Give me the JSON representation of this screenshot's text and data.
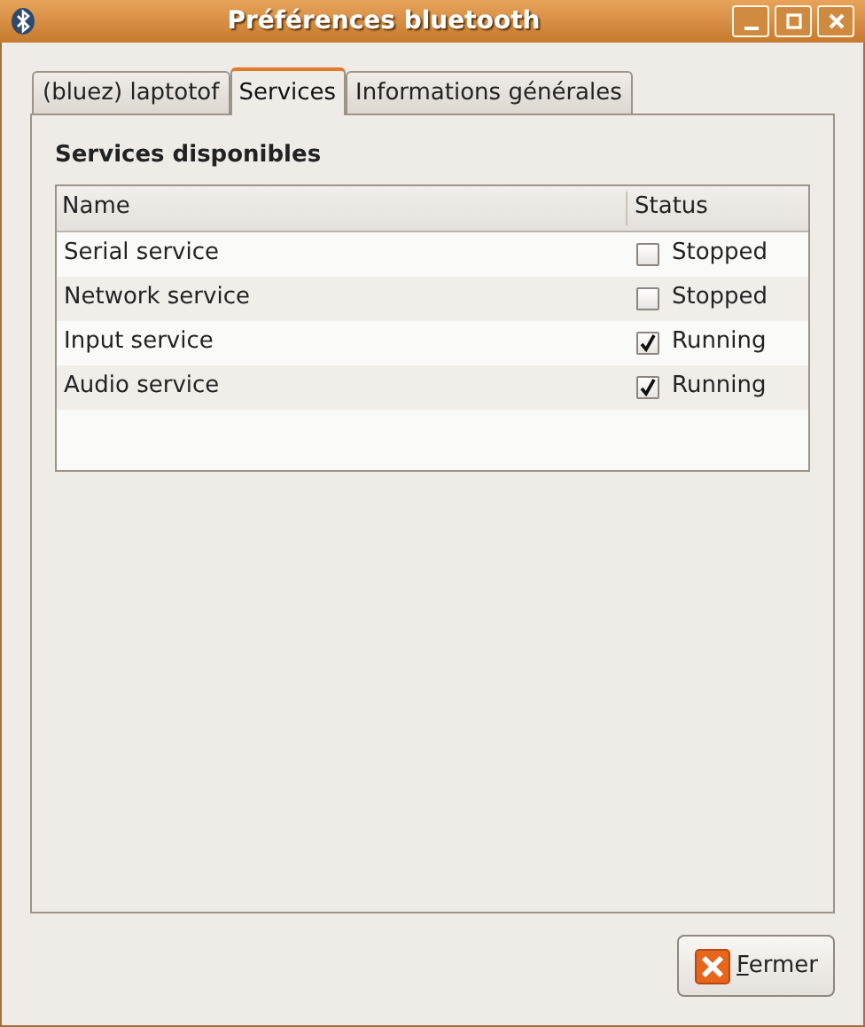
{
  "window": {
    "title": "Préférences bluetooth"
  },
  "tabs": [
    {
      "label": "(bluez) laptotof",
      "selected": false
    },
    {
      "label": "Services",
      "selected": true
    },
    {
      "label": "Informations générales",
      "selected": false
    }
  ],
  "section_title": "Services disponibles",
  "table": {
    "columns": [
      "Name",
      "Status"
    ],
    "rows": [
      {
        "name": "Serial service",
        "checked": false,
        "status": "Stopped"
      },
      {
        "name": "Network service",
        "checked": false,
        "status": "Stopped"
      },
      {
        "name": "Input service",
        "checked": true,
        "status": "Running"
      },
      {
        "name": "Audio service",
        "checked": true,
        "status": "Running"
      }
    ]
  },
  "buttons": [
    {
      "label": "Fermer"
    }
  ]
}
